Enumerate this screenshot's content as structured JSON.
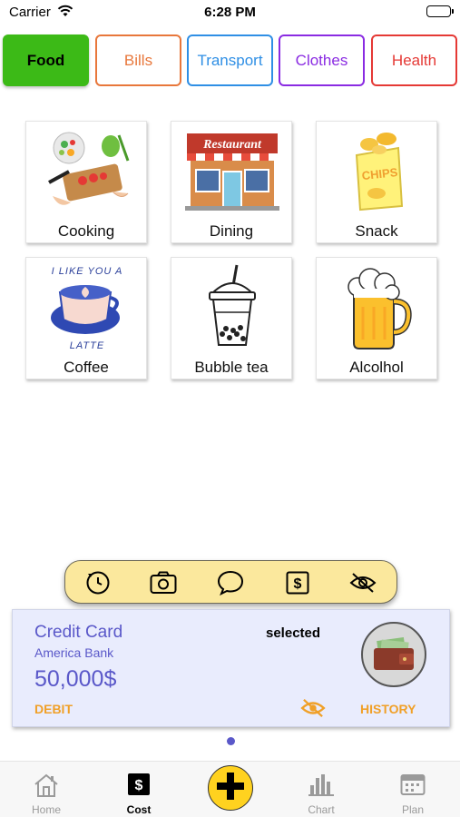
{
  "status_bar": {
    "carrier": "Carrier",
    "time": "6:28 PM"
  },
  "categories": [
    {
      "label": "Food",
      "color": "#3cba17",
      "active": true
    },
    {
      "label": "Bills",
      "color": "#e8773b",
      "active": false
    },
    {
      "label": "Transport",
      "color": "#2f8fe5",
      "active": false
    },
    {
      "label": "Clothes",
      "color": "#8a2be2",
      "active": false
    },
    {
      "label": "Health",
      "color": "#e53935",
      "active": false
    }
  ],
  "items": [
    {
      "label": "Cooking",
      "icon": "cooking-icon"
    },
    {
      "label": "Dining",
      "icon": "restaurant-icon"
    },
    {
      "label": "Snack",
      "icon": "chips-icon"
    },
    {
      "label": "Coffee",
      "icon": "latte-icon"
    },
    {
      "label": "Bubble tea",
      "icon": "bubble-tea-icon"
    },
    {
      "label": "Alcolhol",
      "icon": "beer-icon"
    }
  ],
  "item_art_text": {
    "restaurant_sign": "Restaurant",
    "chips_bag": "CHIPS",
    "latte_top": "I LIKE YOU A",
    "latte_bottom": "LATTE"
  },
  "toolbar": {
    "tools": [
      "history-icon",
      "camera-icon",
      "comment-icon",
      "dollar-icon",
      "hide-icon"
    ]
  },
  "wallet": {
    "name": "Credit Card",
    "bank": "America Bank",
    "amount": "50,000$",
    "type": "DEBIT",
    "status": "selected",
    "history_label": "HISTORY"
  },
  "tab_bar": {
    "items": [
      {
        "label": "Home",
        "icon": "home-icon",
        "active": false
      },
      {
        "label": "Cost",
        "icon": "dollar-square-icon",
        "active": true
      },
      {
        "label": "",
        "icon": "plus-icon",
        "active": false
      },
      {
        "label": "Chart",
        "icon": "bar-chart-icon",
        "active": false
      },
      {
        "label": "Plan",
        "icon": "calendar-icon",
        "active": false
      }
    ]
  },
  "colors": {
    "accent": "#5a58c9",
    "highlight": "#f0a028",
    "toolbar": "#fbe89d",
    "add_button": "#ffd21f"
  }
}
